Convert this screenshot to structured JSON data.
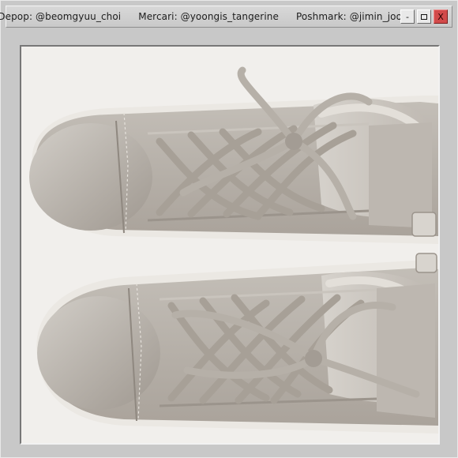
{
  "window": {
    "title_segments": [
      "Depop: @beomgyuu_choi",
      "Mercari: @yoongis_tangerine",
      "Poshmark: @jimin_joon"
    ],
    "controls": {
      "minimize": "-",
      "close": "X"
    }
  },
  "image": {
    "subject_icon": "sneakers-photo",
    "colors": {
      "background": "#f1efec",
      "leather": "#b9b3ac",
      "laces": "#a59f97",
      "sole": "#ebe8e3"
    }
  }
}
